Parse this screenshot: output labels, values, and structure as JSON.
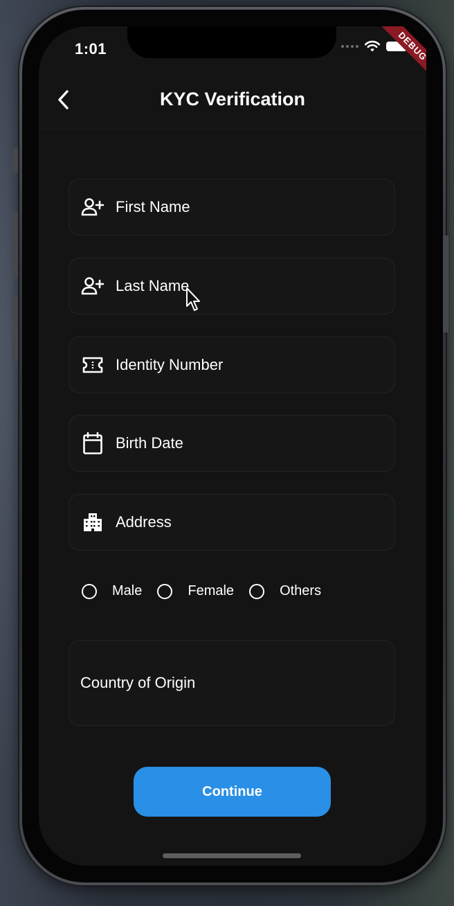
{
  "status_bar": {
    "time": "1:01",
    "debug_banner": "DEBUG"
  },
  "app_bar": {
    "title": "KYC Verification",
    "back_icon": "chevron-left-icon"
  },
  "form": {
    "first_name": {
      "label": "First Name",
      "icon": "person-add-icon"
    },
    "last_name": {
      "label": "Last Name",
      "icon": "person-add-icon"
    },
    "identity_number": {
      "label": "Identity Number",
      "icon": "ticket-icon"
    },
    "birth_date": {
      "label": "Birth Date",
      "icon": "calendar-icon"
    },
    "address": {
      "label": "Address",
      "icon": "building-icon"
    },
    "gender": {
      "options": [
        "Male",
        "Female",
        "Others"
      ],
      "selected": null
    },
    "country": {
      "label": "Country of Origin"
    }
  },
  "actions": {
    "continue_label": "Continue"
  },
  "colors": {
    "background": "#141414",
    "field_border": "#242424",
    "accent": "#2a8fe6",
    "debug_ribbon": "#8b1a24"
  }
}
